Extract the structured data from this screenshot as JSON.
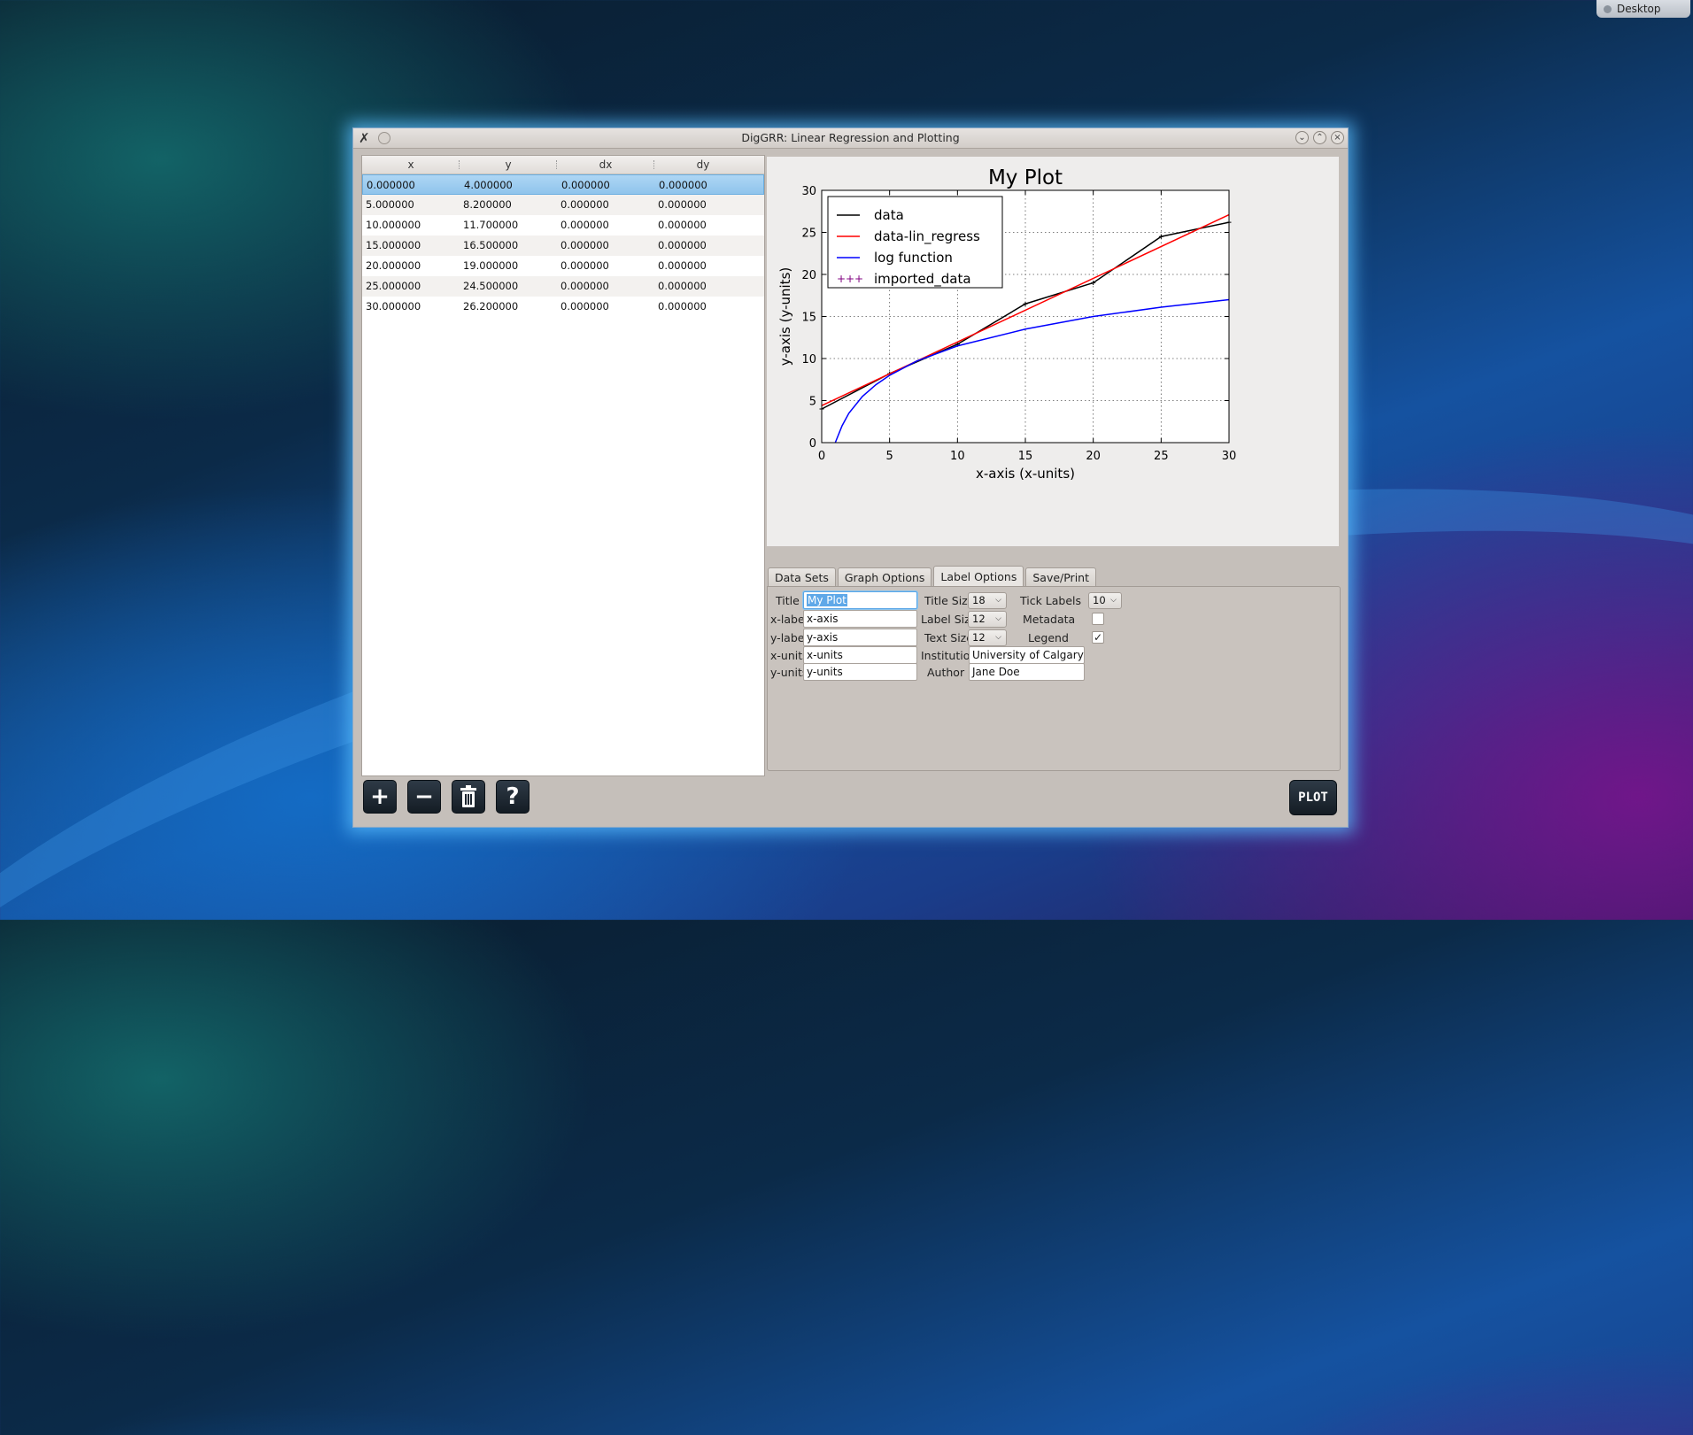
{
  "desktop": {
    "label": "Desktop"
  },
  "window": {
    "title": "DigGRR: Linear Regression and Plotting"
  },
  "table": {
    "columns": [
      "x",
      "y",
      "dx",
      "dy"
    ],
    "rows": [
      [
        "0.000000",
        "4.000000",
        "0.000000",
        "0.000000"
      ],
      [
        "5.000000",
        "8.200000",
        "0.000000",
        "0.000000"
      ],
      [
        "10.000000",
        "11.700000",
        "0.000000",
        "0.000000"
      ],
      [
        "15.000000",
        "16.500000",
        "0.000000",
        "0.000000"
      ],
      [
        "20.000000",
        "19.000000",
        "0.000000",
        "0.000000"
      ],
      [
        "25.000000",
        "24.500000",
        "0.000000",
        "0.000000"
      ],
      [
        "30.000000",
        "26.200000",
        "0.000000",
        "0.000000"
      ]
    ],
    "selected_row": 0
  },
  "chart_data": {
    "type": "line",
    "title": "My Plot",
    "xlabel": "x-axis (x-units)",
    "ylabel": "y-axis (y-units)",
    "xlim": [
      0,
      30
    ],
    "ylim": [
      0,
      30
    ],
    "xticks": [
      0,
      5,
      10,
      15,
      20,
      25,
      30
    ],
    "yticks": [
      0,
      5,
      10,
      15,
      20,
      25,
      30
    ],
    "grid": true,
    "legend_position": "top-left",
    "series": [
      {
        "name": "data",
        "color": "#000000",
        "style": "line-with-markers",
        "x": [
          0,
          5,
          10,
          15,
          20,
          25,
          30
        ],
        "y": [
          4.0,
          8.2,
          11.7,
          16.5,
          19.0,
          24.5,
          26.2
        ]
      },
      {
        "name": "data-lin_regress",
        "color": "#ff0000",
        "style": "line",
        "x": [
          0,
          30
        ],
        "y": [
          4.4,
          27.1
        ]
      },
      {
        "name": "log function",
        "color": "#0000ff",
        "style": "line",
        "x": [
          1,
          1.5,
          2,
          3,
          4,
          5,
          7,
          10,
          15,
          20,
          25,
          30
        ],
        "y": [
          0,
          2.0,
          3.5,
          5.5,
          6.9,
          8.0,
          9.7,
          11.5,
          13.5,
          15.0,
          16.1,
          17.0
        ]
      },
      {
        "name": "imported_data",
        "color": "#800080",
        "style": "markers",
        "x": [],
        "y": []
      }
    ]
  },
  "tabs": [
    "Data Sets",
    "Graph Options",
    "Label Options",
    "Save/Print"
  ],
  "active_tab": "Label Options",
  "label_options": {
    "title_label": "Title",
    "title_value": "My Plot",
    "xlabel_label": "x-label",
    "xlabel_value": "x-axis",
    "ylabel_label": "y-label",
    "ylabel_value": "y-axis",
    "xunits_label": "x-units",
    "xunits_value": "x-units",
    "yunits_label": "y-units",
    "yunits_value": "y-units",
    "title_size_label": "Title Size",
    "title_size_value": "18",
    "label_size_label": "Label Size",
    "label_size_value": "12",
    "text_size_label": "Text Size",
    "text_size_value": "12",
    "institution_label": "Institution",
    "institution_value": "University of Calgary",
    "author_label": "Author",
    "author_value": "Jane Doe",
    "tick_labels_label": "Tick Labels",
    "tick_labels_value": "10",
    "metadata_label": "Metadata",
    "metadata_checked": false,
    "legend_label": "Legend",
    "legend_checked": true
  },
  "toolbar": {
    "add_icon": "plus-icon",
    "add_glyph": "+",
    "remove_icon": "minus-icon",
    "remove_glyph": "−",
    "delete_icon": "trash-icon",
    "help_icon": "question-icon",
    "help_glyph": "?",
    "plot_label": "PLOT"
  },
  "checkmark": "✓"
}
